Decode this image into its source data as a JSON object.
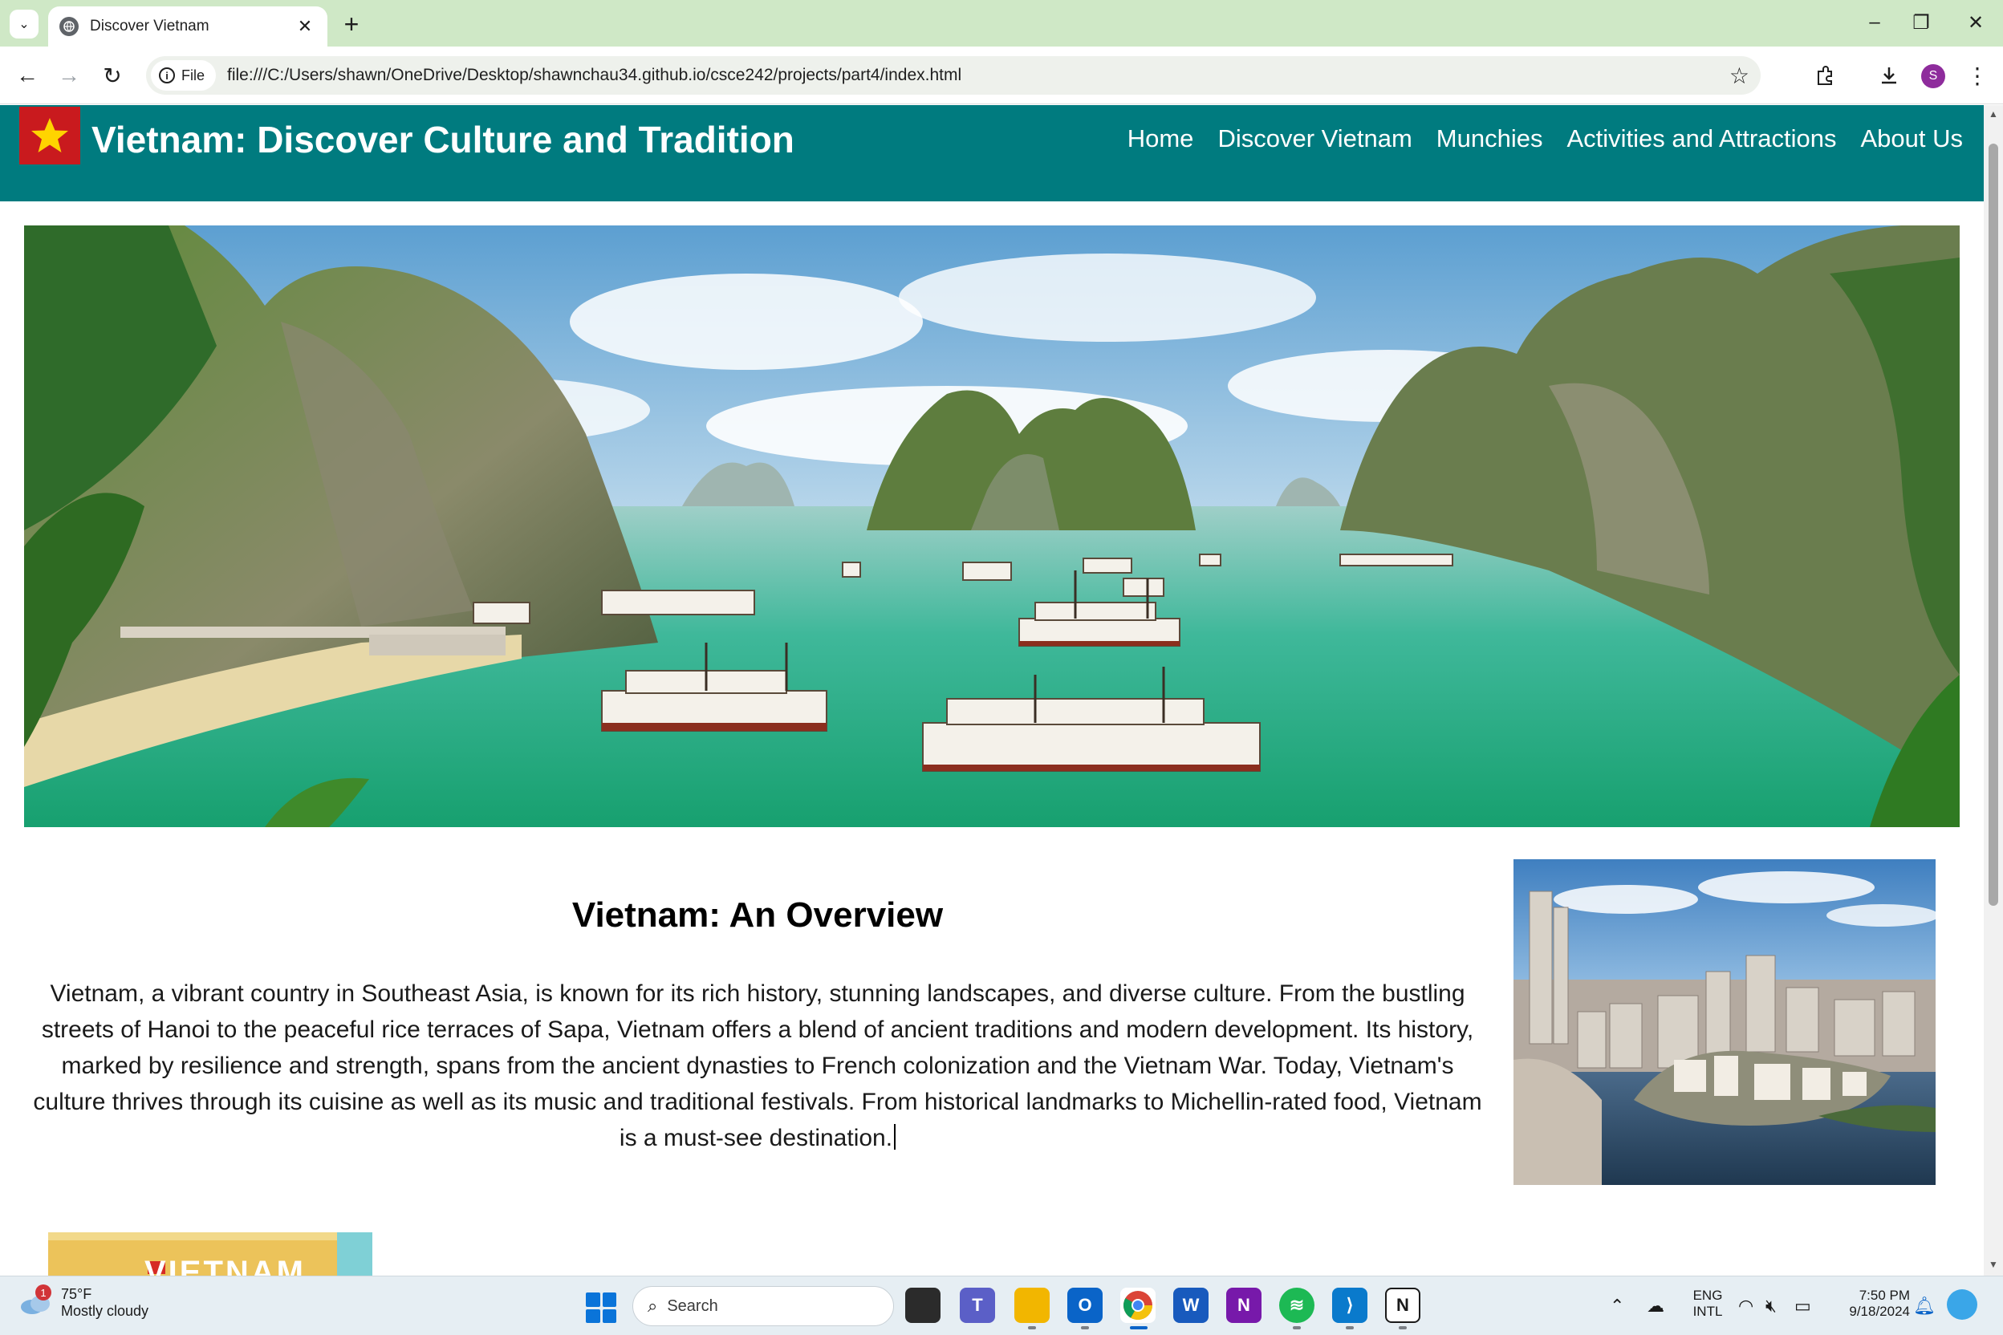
{
  "browser": {
    "tab_title": "Discover Vietnam",
    "site_chip": "File",
    "url": "file:///C:/Users/shawn/OneDrive/Desktop/shawnchau34.github.io/csce242/projects/part4/index.html",
    "profile_initial": "S"
  },
  "site": {
    "title": "Vietnam: Discover Culture and Tradition",
    "nav": [
      "Home",
      "Discover Vietnam",
      "Munchies",
      "Activities and Attractions",
      "About Us"
    ],
    "colors": {
      "header": "#007b7f",
      "flag": "#c91a1e",
      "star": "#ffd400"
    }
  },
  "overview": {
    "title": "Vietnam: An Overview",
    "text": "Vietnam, a vibrant country in Southeast Asia, is known for its rich history, stunning landscapes, and diverse culture. From the bustling streets of Hanoi to the peaceful rice terraces of Sapa, Vietnam offers a blend of ancient traditions and modern development. Its history, marked by resilience and strength, spans from the ancient dynasties to French colonization and the Vietnam War. Today, Vietnam's culture thrives through its cuisine as well as its music and traditional festivals. From historical landmarks to Michellin-rated food, Vietnam is a must-see destination."
  },
  "bottom_card": {
    "text": "VIETNAM"
  },
  "taskbar": {
    "weather_badge": "1",
    "weather_temp": "75°F",
    "weather_desc": "Mostly cloudy",
    "search_label": "Search",
    "lang_top": "ENG",
    "lang_bottom": "INTL",
    "time": "7:50 PM",
    "date": "9/18/2024"
  }
}
